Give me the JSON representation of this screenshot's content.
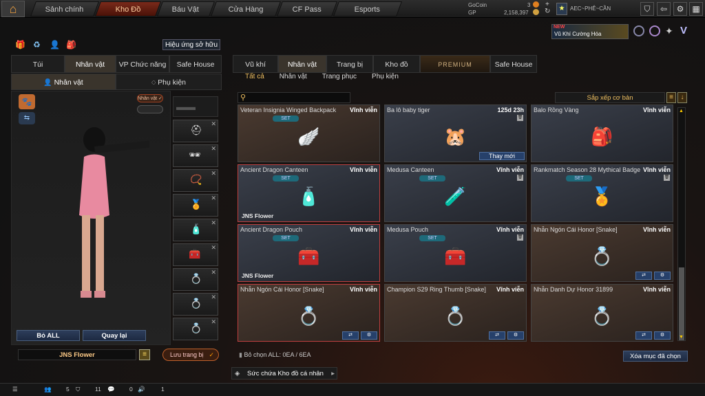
{
  "nav": {
    "tabs": [
      "Sảnh chính",
      "Kho Đồ",
      "Báu Vật",
      "Cửa Hàng",
      "CF Pass",
      "Esports"
    ],
    "active": "Kho Đồ"
  },
  "currency": {
    "gocoin_label": "GoCoin",
    "gocoin_value": "3",
    "gp_label": "GP",
    "gp_value": "2,158,397"
  },
  "player": {
    "clan": "AEC~PHÊ~CẦN"
  },
  "promo": {
    "badge": "NEW",
    "text": "Vũ Khí Cường Hóa"
  },
  "left": {
    "effect_button": "Hiệu ứng sở hữu",
    "tabs": [
      "Túi",
      "Nhân vật",
      "VP Chức năng",
      "Safe House"
    ],
    "active_tab": "Nhân vật",
    "subtabs": [
      "Nhân vật",
      "Phụ kiện"
    ],
    "char_badge": "Nhân vật ✓",
    "btn_remove_all": "Bỏ ALL",
    "btn_back": "Quay lại",
    "preset_name": "JNS Flower",
    "save_button": "Lưu trang bị"
  },
  "right": {
    "tabs": [
      "Vũ khí",
      "Nhân vật",
      "Trang bị",
      "Kho đồ",
      "PREMIUM",
      "Safe House"
    ],
    "active_tab": "Nhân vật",
    "subtabs": [
      "Tất cả",
      "Nhân vật",
      "Trang phục",
      "Phụ kiện"
    ],
    "active_subtab": "Tất cả",
    "search_placeholder": "",
    "sort_label": "Sắp xếp cơ bản"
  },
  "items": [
    {
      "name": "Veteran Insignia Winged Backpack",
      "duration": "Vĩnh viễn",
      "set": "SET",
      "sub": "",
      "icon": "🪽",
      "style": "brown"
    },
    {
      "name": "Ba lô baby tiger",
      "duration": "125d 23h",
      "set": "",
      "sub": "",
      "icon": "🐹",
      "style": "blue",
      "action": "Thay mới"
    },
    {
      "name": "Balo Rồng Vàng",
      "duration": "Vĩnh viễn",
      "set": "",
      "sub": "",
      "icon": "🎒",
      "style": "blue"
    },
    {
      "name": "Ancient Dragon Canteen",
      "duration": "Vĩnh viễn",
      "set": "SET",
      "sub": "JNS Flower",
      "icon": "🧴",
      "style": "blue",
      "hl": true
    },
    {
      "name": "Medusa Canteen",
      "duration": "Vĩnh viễn",
      "set": "SET",
      "sub": "",
      "icon": "🧪",
      "style": "blue"
    },
    {
      "name": "Rankmatch Season 28 Mythical Badge",
      "duration": "Vĩnh viễn",
      "set": "SET",
      "sub": "",
      "icon": "🏅",
      "style": "blue"
    },
    {
      "name": "Ancient Dragon Pouch",
      "duration": "Vĩnh viễn",
      "set": "SET",
      "sub": "JNS Flower",
      "icon": "🧰",
      "style": "blue",
      "hl": true
    },
    {
      "name": "Medusa Pouch",
      "duration": "Vĩnh viễn",
      "set": "SET",
      "sub": "",
      "icon": "🧰",
      "style": "blue"
    },
    {
      "name": "Nhẫn Ngón Cái Honor [Snake]",
      "duration": "Vĩnh viễn",
      "set": "",
      "sub": "",
      "icon": "💍",
      "style": "brown"
    },
    {
      "name": "Nhẫn Ngón Cái Honor [Snake]",
      "duration": "Vĩnh viễn",
      "set": "",
      "sub": "",
      "icon": "💍",
      "style": "brown",
      "hl": true
    },
    {
      "name": "Champion S29 Ring Thumb [Snake]",
      "duration": "Vĩnh viễn",
      "set": "",
      "sub": "",
      "icon": "💍",
      "style": "brown"
    },
    {
      "name": "Nhẫn Danh Dự Honor 31899",
      "duration": "Vĩnh viễn",
      "set": "",
      "sub": "",
      "icon": "💍",
      "style": "brown"
    }
  ],
  "footer": {
    "select_all_text": "Bỏ chọn ALL: 0EA / 6EA",
    "delete_button": "Xóa mục đã chọn",
    "capacity_text": "Sức chứa Kho đồ cá nhân"
  },
  "status": {
    "v1": "5",
    "v2": "11",
    "v3": "0",
    "v4": "1"
  }
}
